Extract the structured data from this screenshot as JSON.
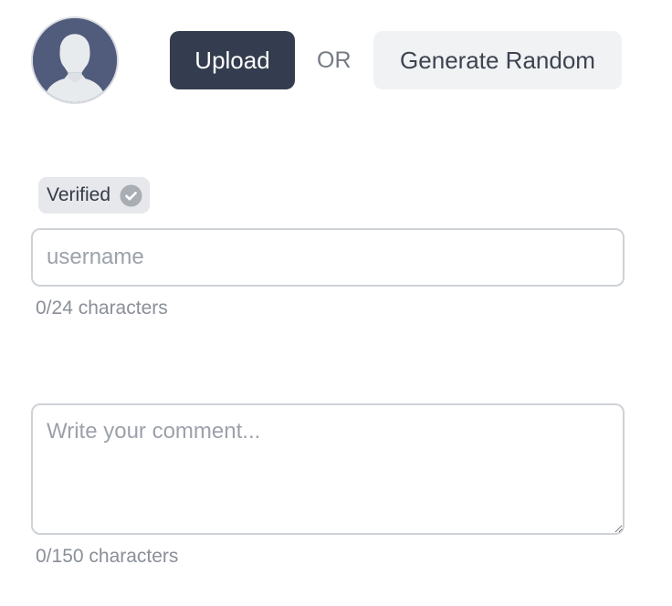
{
  "avatar": {
    "icon": "default-user-avatar-icon",
    "background_color": "#515c7d",
    "figure_color": "#e8ebee"
  },
  "actions": {
    "upload_label": "Upload",
    "separator_label": "OR",
    "generate_random_label": "Generate Random"
  },
  "badge": {
    "label": "Verified",
    "icon": "check-circle-icon"
  },
  "username": {
    "value": "",
    "placeholder": "username",
    "counter": "0/24 characters"
  },
  "comment": {
    "value": "",
    "placeholder": "Write your comment...",
    "counter": "0/150 characters"
  },
  "colors": {
    "primary_button": "#343d4f",
    "secondary_button": "#f1f2f4",
    "badge_background": "#e7e8eb",
    "muted_text": "#8a8f98"
  }
}
